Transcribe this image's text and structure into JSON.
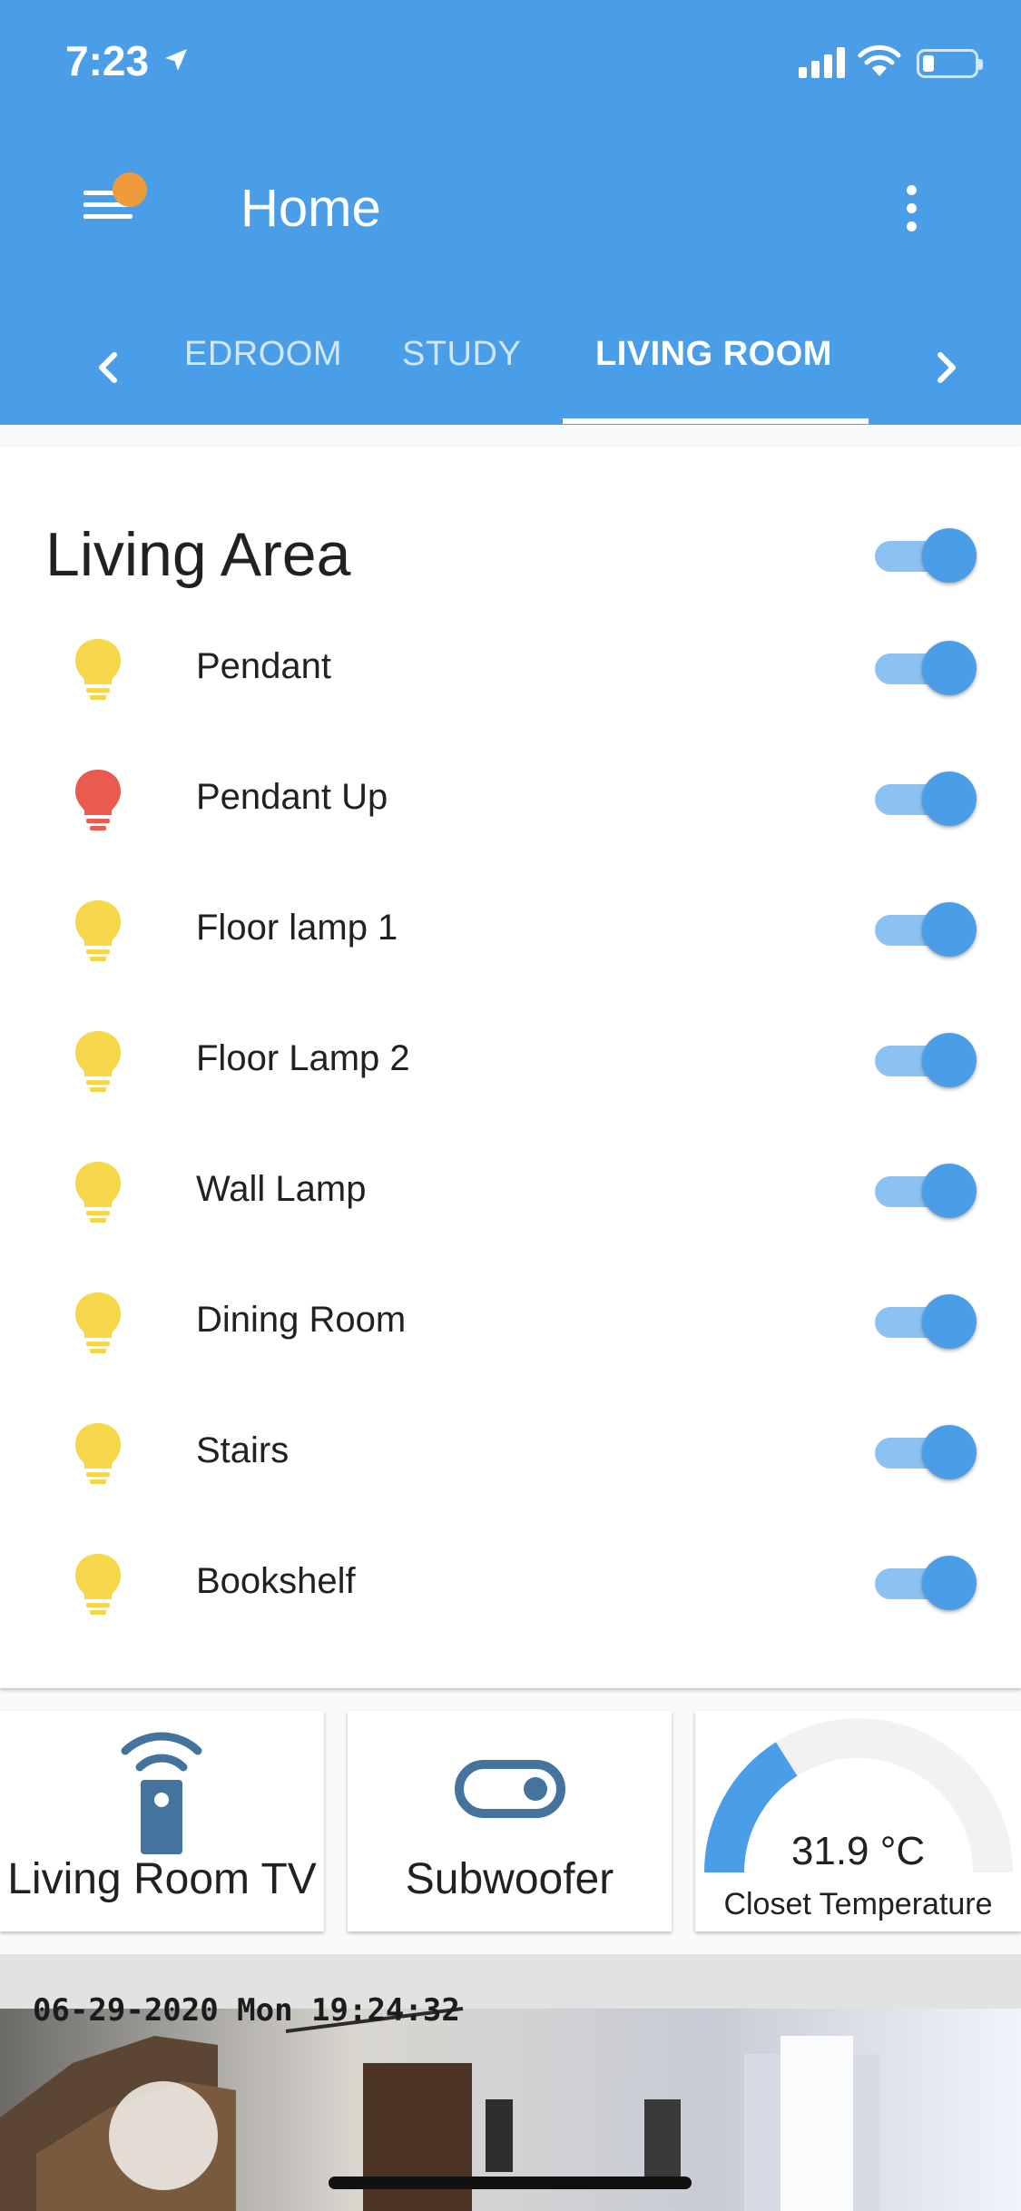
{
  "status_bar": {
    "time": "7:23"
  },
  "header": {
    "title": "Home"
  },
  "tabs": [
    {
      "label": "EDROOM"
    },
    {
      "label": "STUDY"
    },
    {
      "label": "LIVING ROOM",
      "active": true
    }
  ],
  "card": {
    "title": "Living Area",
    "master_toggle_on": true,
    "items": [
      {
        "label": "Pendant",
        "icon": "bulb-icon",
        "color": "#f6d64a",
        "on": true
      },
      {
        "label": "Pendant Up",
        "icon": "bulb-icon",
        "color": "#e95b50",
        "on": true
      },
      {
        "label": "Floor lamp 1",
        "icon": "bulb-icon",
        "color": "#f6d64a",
        "on": true
      },
      {
        "label": "Floor Lamp 2",
        "icon": "bulb-icon",
        "color": "#f6d64a",
        "on": true
      },
      {
        "label": "Wall Lamp",
        "icon": "bulb-icon",
        "color": "#f6d64a",
        "on": true
      },
      {
        "label": "Dining Room",
        "icon": "bulb-icon",
        "color": "#f6d64a",
        "on": true
      },
      {
        "label": "Stairs",
        "icon": "bulb-icon",
        "color": "#f6d64a",
        "on": true
      },
      {
        "label": "Bookshelf",
        "icon": "bulb-icon",
        "color": "#f6d64a",
        "on": true
      }
    ]
  },
  "tiles": {
    "tv": {
      "label": "Living Room TV",
      "icon": "remote-icon"
    },
    "subwoofer": {
      "label": "Subwoofer",
      "icon": "toggle-icon"
    },
    "gauge": {
      "value": "31.9 °C",
      "label": "Closet Temperature",
      "fraction": 0.32
    }
  },
  "camera": {
    "timestamp": "06-29-2020 Mon 19:24:32"
  },
  "colors": {
    "accent": "#4a9ee8",
    "bulb_on": "#f6d64a",
    "bulb_alt": "#e95b50",
    "tile_icon": "#44739e"
  }
}
